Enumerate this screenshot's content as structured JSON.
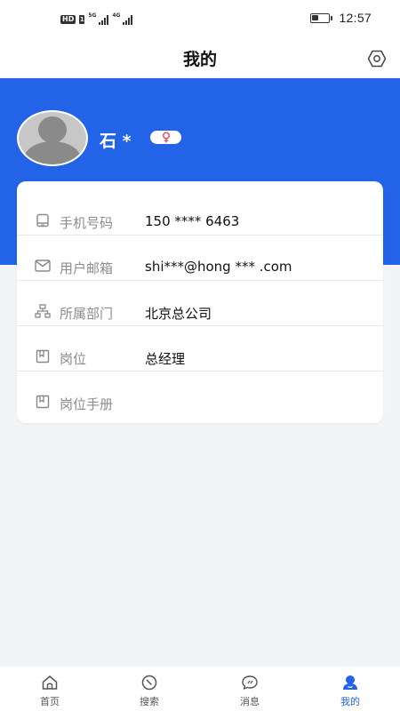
{
  "status_bar": {
    "hd": "HD",
    "sim": "1",
    "net1": "5G",
    "net2": "4G",
    "battery_level": 0.4,
    "time": "12:57"
  },
  "header": {
    "title": "我的",
    "settings_icon": "settings-hexagon-icon"
  },
  "profile": {
    "name": "石 *",
    "gender_icon": "female-icon",
    "colors": {
      "band": "#2363e8",
      "gender": "#e05a6a"
    }
  },
  "info_rows": [
    {
      "icon": "phone-icon",
      "label": "手机号码",
      "value": "150 **** 6463"
    },
    {
      "icon": "mail-icon",
      "label": "用户邮箱",
      "value": "shi***@hong *** .com"
    },
    {
      "icon": "org-chart-icon",
      "label": "所属部门",
      "value": "北京总公司"
    },
    {
      "icon": "bookmark-icon",
      "label": "岗位",
      "value": "总经理"
    },
    {
      "icon": "bookmark-icon",
      "label": "岗位手册",
      "value": ""
    }
  ],
  "bottom_nav": {
    "active_color": "#2363e8",
    "items": [
      {
        "label": "首页",
        "icon": "home-icon",
        "active": false
      },
      {
        "label": "搜索",
        "icon": "compass-icon",
        "active": false
      },
      {
        "label": "消息",
        "icon": "message-icon",
        "active": false
      },
      {
        "label": "我的",
        "icon": "profile-icon",
        "active": true
      }
    ]
  }
}
